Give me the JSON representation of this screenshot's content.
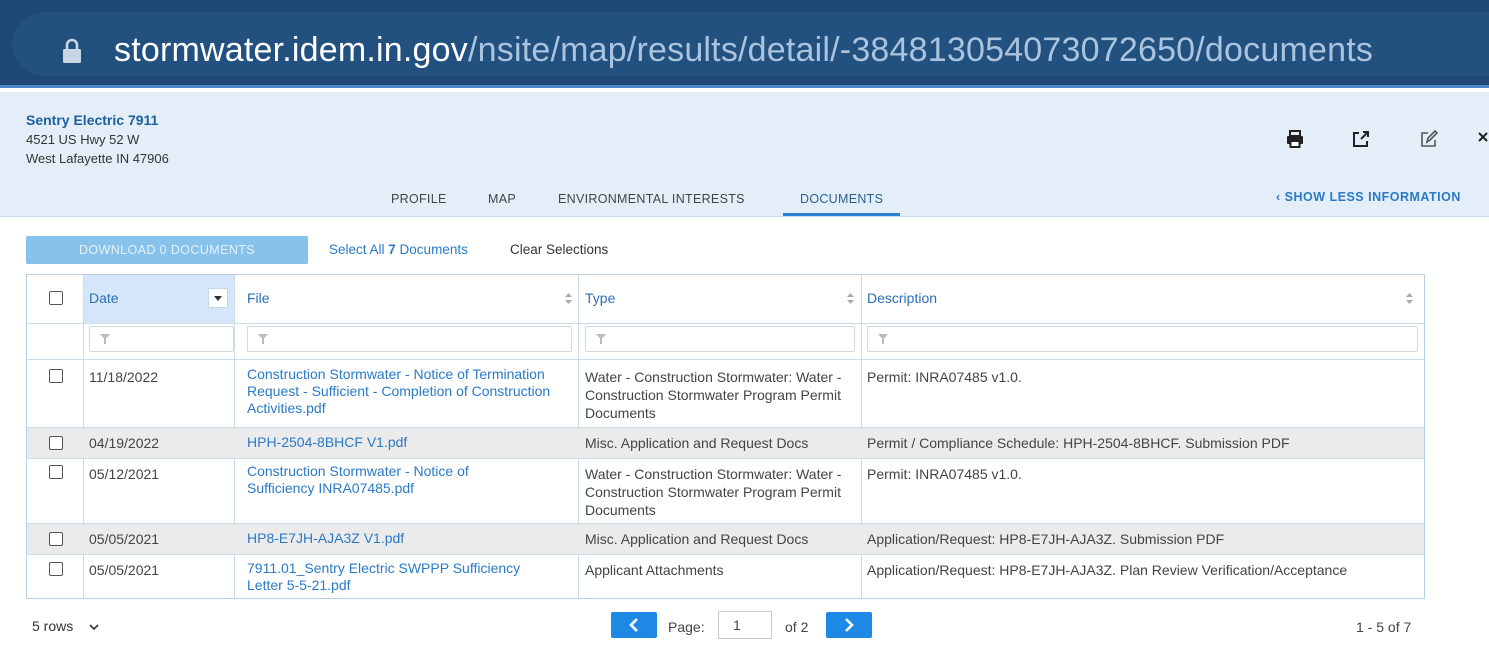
{
  "browser": {
    "url_host": "stormwater.idem.in.gov",
    "url_path": "/nsite/map/results/detail/-3848130540730726​50/documents"
  },
  "facility": {
    "name": "Sentry Electric 7911",
    "address_line1": "4521 US Hwy 52 W",
    "address_line2": "West Lafayette IN 47906"
  },
  "header_icons": [
    "print-icon",
    "external-link-icon",
    "edit-icon",
    "close-icon"
  ],
  "tabs": [
    {
      "label": "PROFILE",
      "active": false
    },
    {
      "label": "MAP",
      "active": false
    },
    {
      "label": "ENVIRONMENTAL INTERESTS",
      "active": false
    },
    {
      "label": "DOCUMENTS",
      "active": true
    }
  ],
  "show_less_label": "SHOW LESS INFORMATION",
  "toolbar": {
    "download_label": "DOWNLOAD 0 DOCUMENTS",
    "select_all_prefix": "Select All ",
    "select_all_count": "7",
    "select_all_suffix": " Documents",
    "clear_label": "Clear Selections"
  },
  "table": {
    "columns": [
      "Date",
      "File",
      "Type",
      "Description"
    ],
    "rows": [
      {
        "date": "11/18/2022",
        "file": "Construction Stormwater - Notice of Termination Request - Sufficient - Completion of Construction Activities.pdf",
        "type": "Water - Construction Stormwater: Water - Construction Stormwater Program Permit Documents",
        "description": "Permit: INRA07485 v1.0."
      },
      {
        "date": "04/19/2022",
        "file": "HPH-2504-8BHCF V1.pdf",
        "type": "Misc. Application and Request Docs",
        "description": "Permit / Compliance Schedule: HPH-2504-8BHCF. Submission PDF"
      },
      {
        "date": "05/12/2021",
        "file": "Construction Stormwater - Notice of Sufficiency INRA07485.pdf",
        "type": "Water - Construction Stormwater: Water - Construction Stormwater Program Permit Documents",
        "description": "Permit: INRA07485 v1.0."
      },
      {
        "date": "05/05/2021",
        "file": "HP8-E7JH-AJA3Z V1.pdf",
        "type": "Misc. Application and Request Docs",
        "description": "Application/Request: HP8-E7JH-AJA3Z. Submission PDF"
      },
      {
        "date": "05/05/2021",
        "file": "7911.01_Sentry Electric SWPPP Sufficiency Letter 5-5-21.pdf",
        "type": "Applicant Attachments",
        "description": "Application/Request: HP8-E7JH-AJA3Z. Plan Review Verification/Acceptance"
      }
    ]
  },
  "footer": {
    "rows_per_page": "5 rows",
    "page_label": "Page:",
    "page_value": "1",
    "of_label": "of 2",
    "range_label": "1 - 5 of 7"
  }
}
